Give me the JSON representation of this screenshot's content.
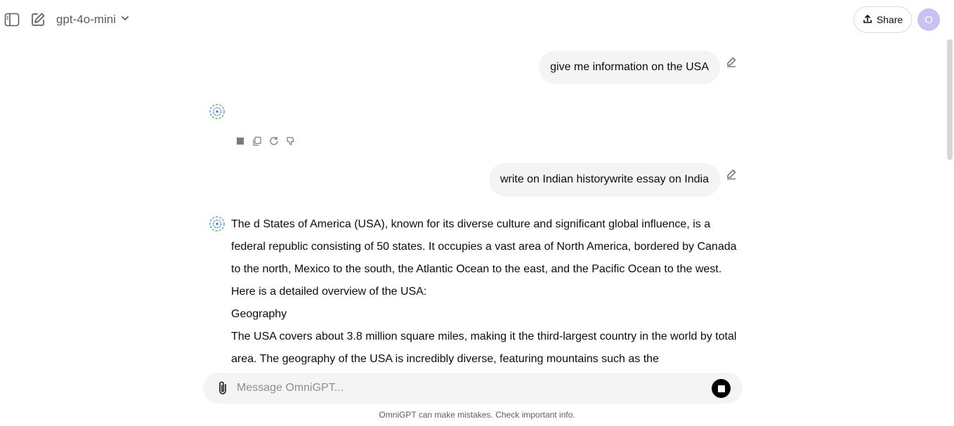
{
  "header": {
    "model_name": "gpt-4o-mini",
    "share_label": "Share",
    "avatar_initial": "O"
  },
  "icons": {
    "sidebar": "sidebar-toggle-icon",
    "new_chat": "compose-icon",
    "model_dropdown": "chevron-down-icon",
    "share": "upload-icon",
    "edit": "pencil-icon",
    "assistant": "omnigpt-logo-icon",
    "stop": "stop-icon",
    "copy": "copy-icon",
    "regenerate": "refresh-icon",
    "dislike": "thumbs-down-icon",
    "attach": "paperclip-icon"
  },
  "conversation": {
    "user_message_1": "give me information on the USA",
    "user_message_2": "write on Indian historywrite essay on India",
    "assistant_answer": [
      "The d States of America (USA), known for its diverse culture and significant global influence, is a federal republic consisting of 50 states. It occupies a vast area of North America, bordered by Canada to the north, Mexico to the south, the Atlantic Ocean to the east, and the Pacific Ocean to the west. Here is a detailed overview of the USA:",
      "Geography",
      "The USA covers about 3.8 million square miles, making it the third-largest country in the world by total area. The geography of the USA is incredibly diverse, featuring mountains such as the"
    ]
  },
  "composer": {
    "placeholder": "Message OmniGPT..."
  },
  "footer": {
    "disclaimer": "OmniGPT can make mistakes. Check important info."
  },
  "colors": {
    "bubble_bg": "#f4f4f4",
    "avatar_bg": "#c8c2f4",
    "logo_green": "#3cb371",
    "logo_blue": "#3b6fd8"
  }
}
